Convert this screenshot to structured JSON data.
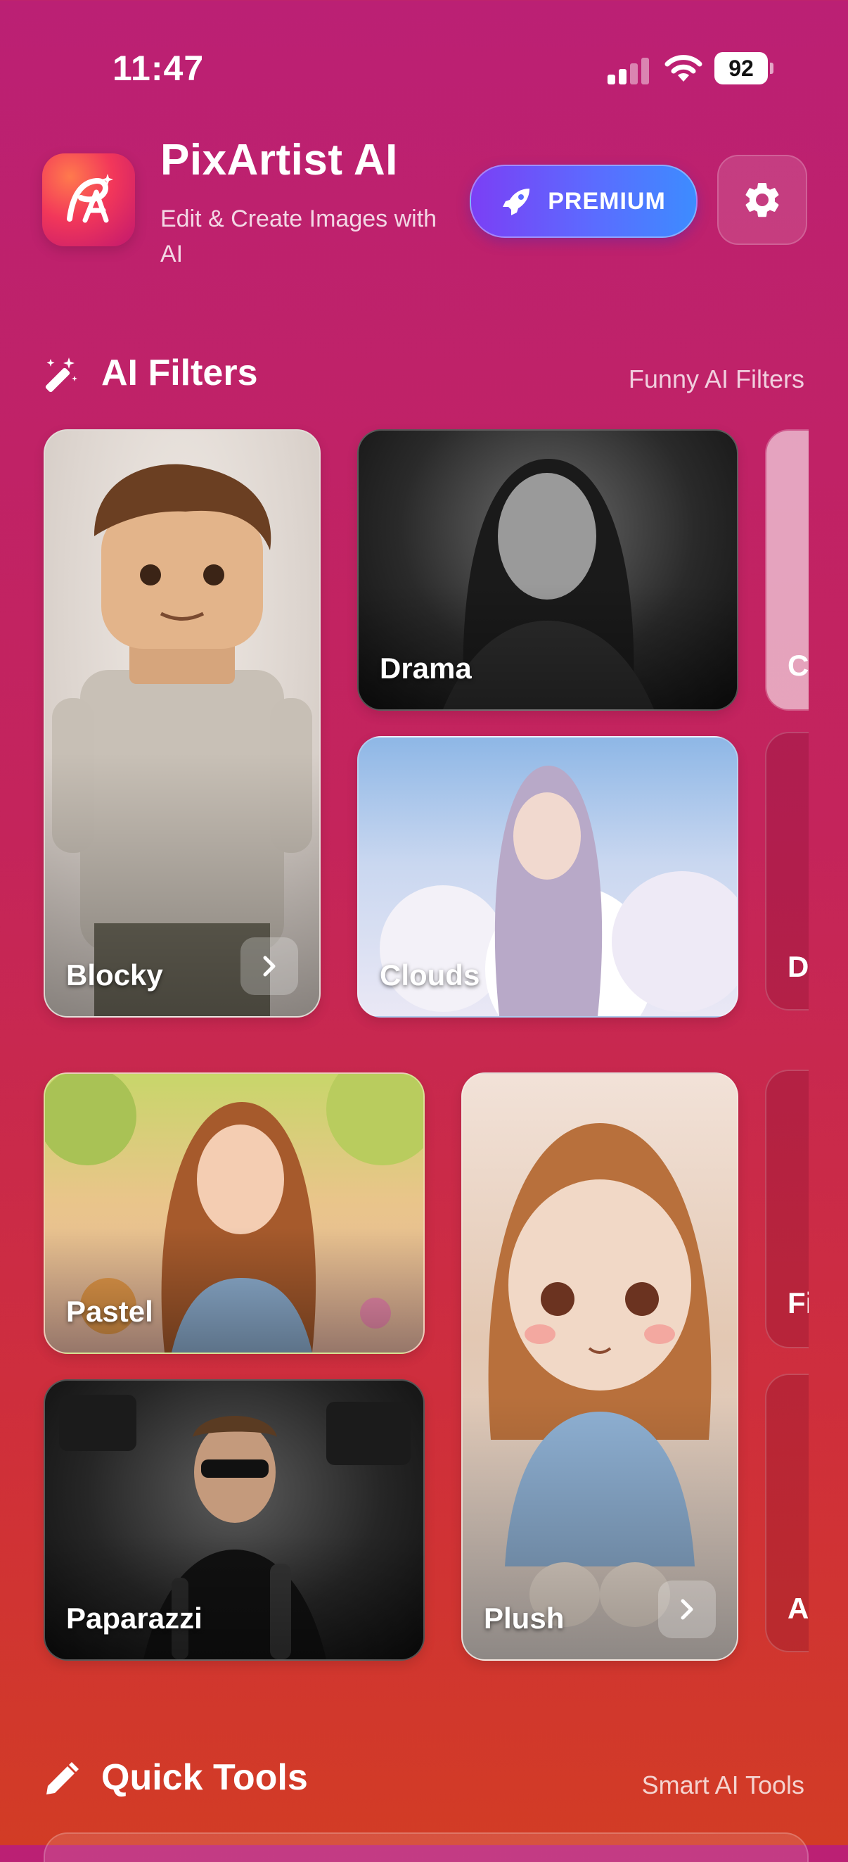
{
  "status_bar": {
    "time": "11:47",
    "battery": "92"
  },
  "header": {
    "app_name": "PixArtist AI",
    "subtitle": "Edit & Create Images with AI",
    "premium_label": "PREMIUM"
  },
  "ai_filters": {
    "title": "AI Filters",
    "link": "Funny AI Filters",
    "cards": [
      {
        "label": "Blocky"
      },
      {
        "label": "Drama"
      },
      {
        "label": "Clouds"
      },
      {
        "label": "Pastel"
      },
      {
        "label": "Paparazzi"
      },
      {
        "label": "Plush"
      }
    ],
    "peek_labels": [
      "C",
      "D",
      "Fi",
      "A"
    ]
  },
  "quick_tools": {
    "title": "Quick Tools",
    "link": "Smart AI Tools"
  },
  "colors": {
    "premium_start": "#7b3ff5",
    "premium_end": "#3d8cff",
    "bg_top": "#bb2074",
    "bg_bottom": "#d23c25"
  },
  "icons": [
    "wand-icon",
    "pencil-icon",
    "gear-icon",
    "rocket-icon",
    "chevron-right-icon"
  ]
}
